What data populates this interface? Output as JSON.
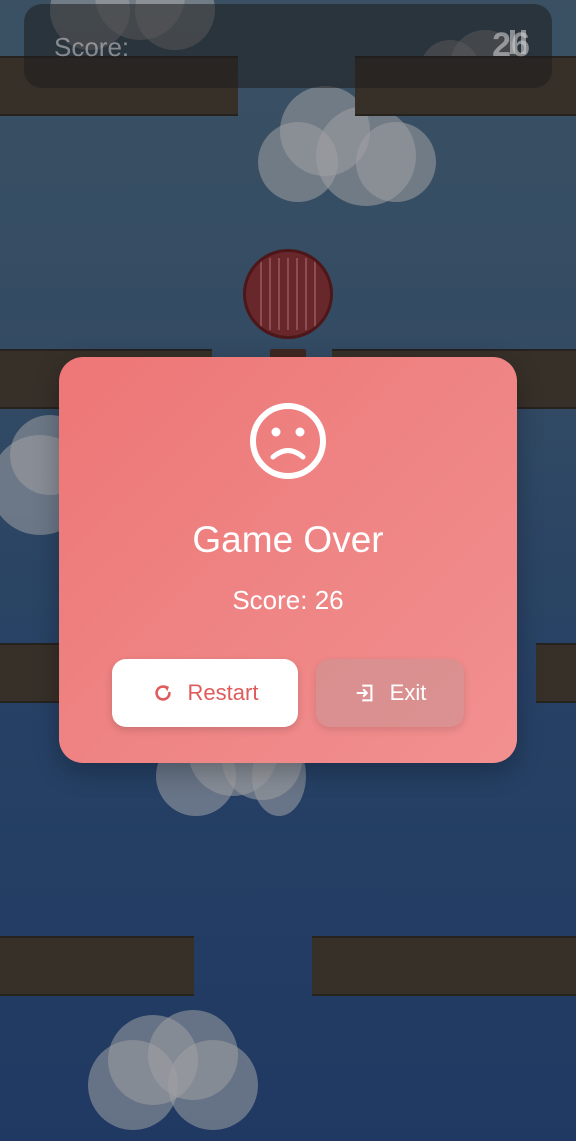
{
  "hud": {
    "score_label": "Score:",
    "score_value": "26"
  },
  "dialog": {
    "icon": "sad-face-icon",
    "title": "Game Over",
    "score_text": "Score: 26",
    "restart_label": "Restart",
    "restart_icon": "restart-icon",
    "exit_label": "Exit",
    "exit_icon": "exit-icon"
  },
  "colors": {
    "dialog_bg": "#ef7f7f",
    "restart_text": "#e05b5b",
    "platform": "#3f3529",
    "balloon": "#7a2a2a"
  }
}
